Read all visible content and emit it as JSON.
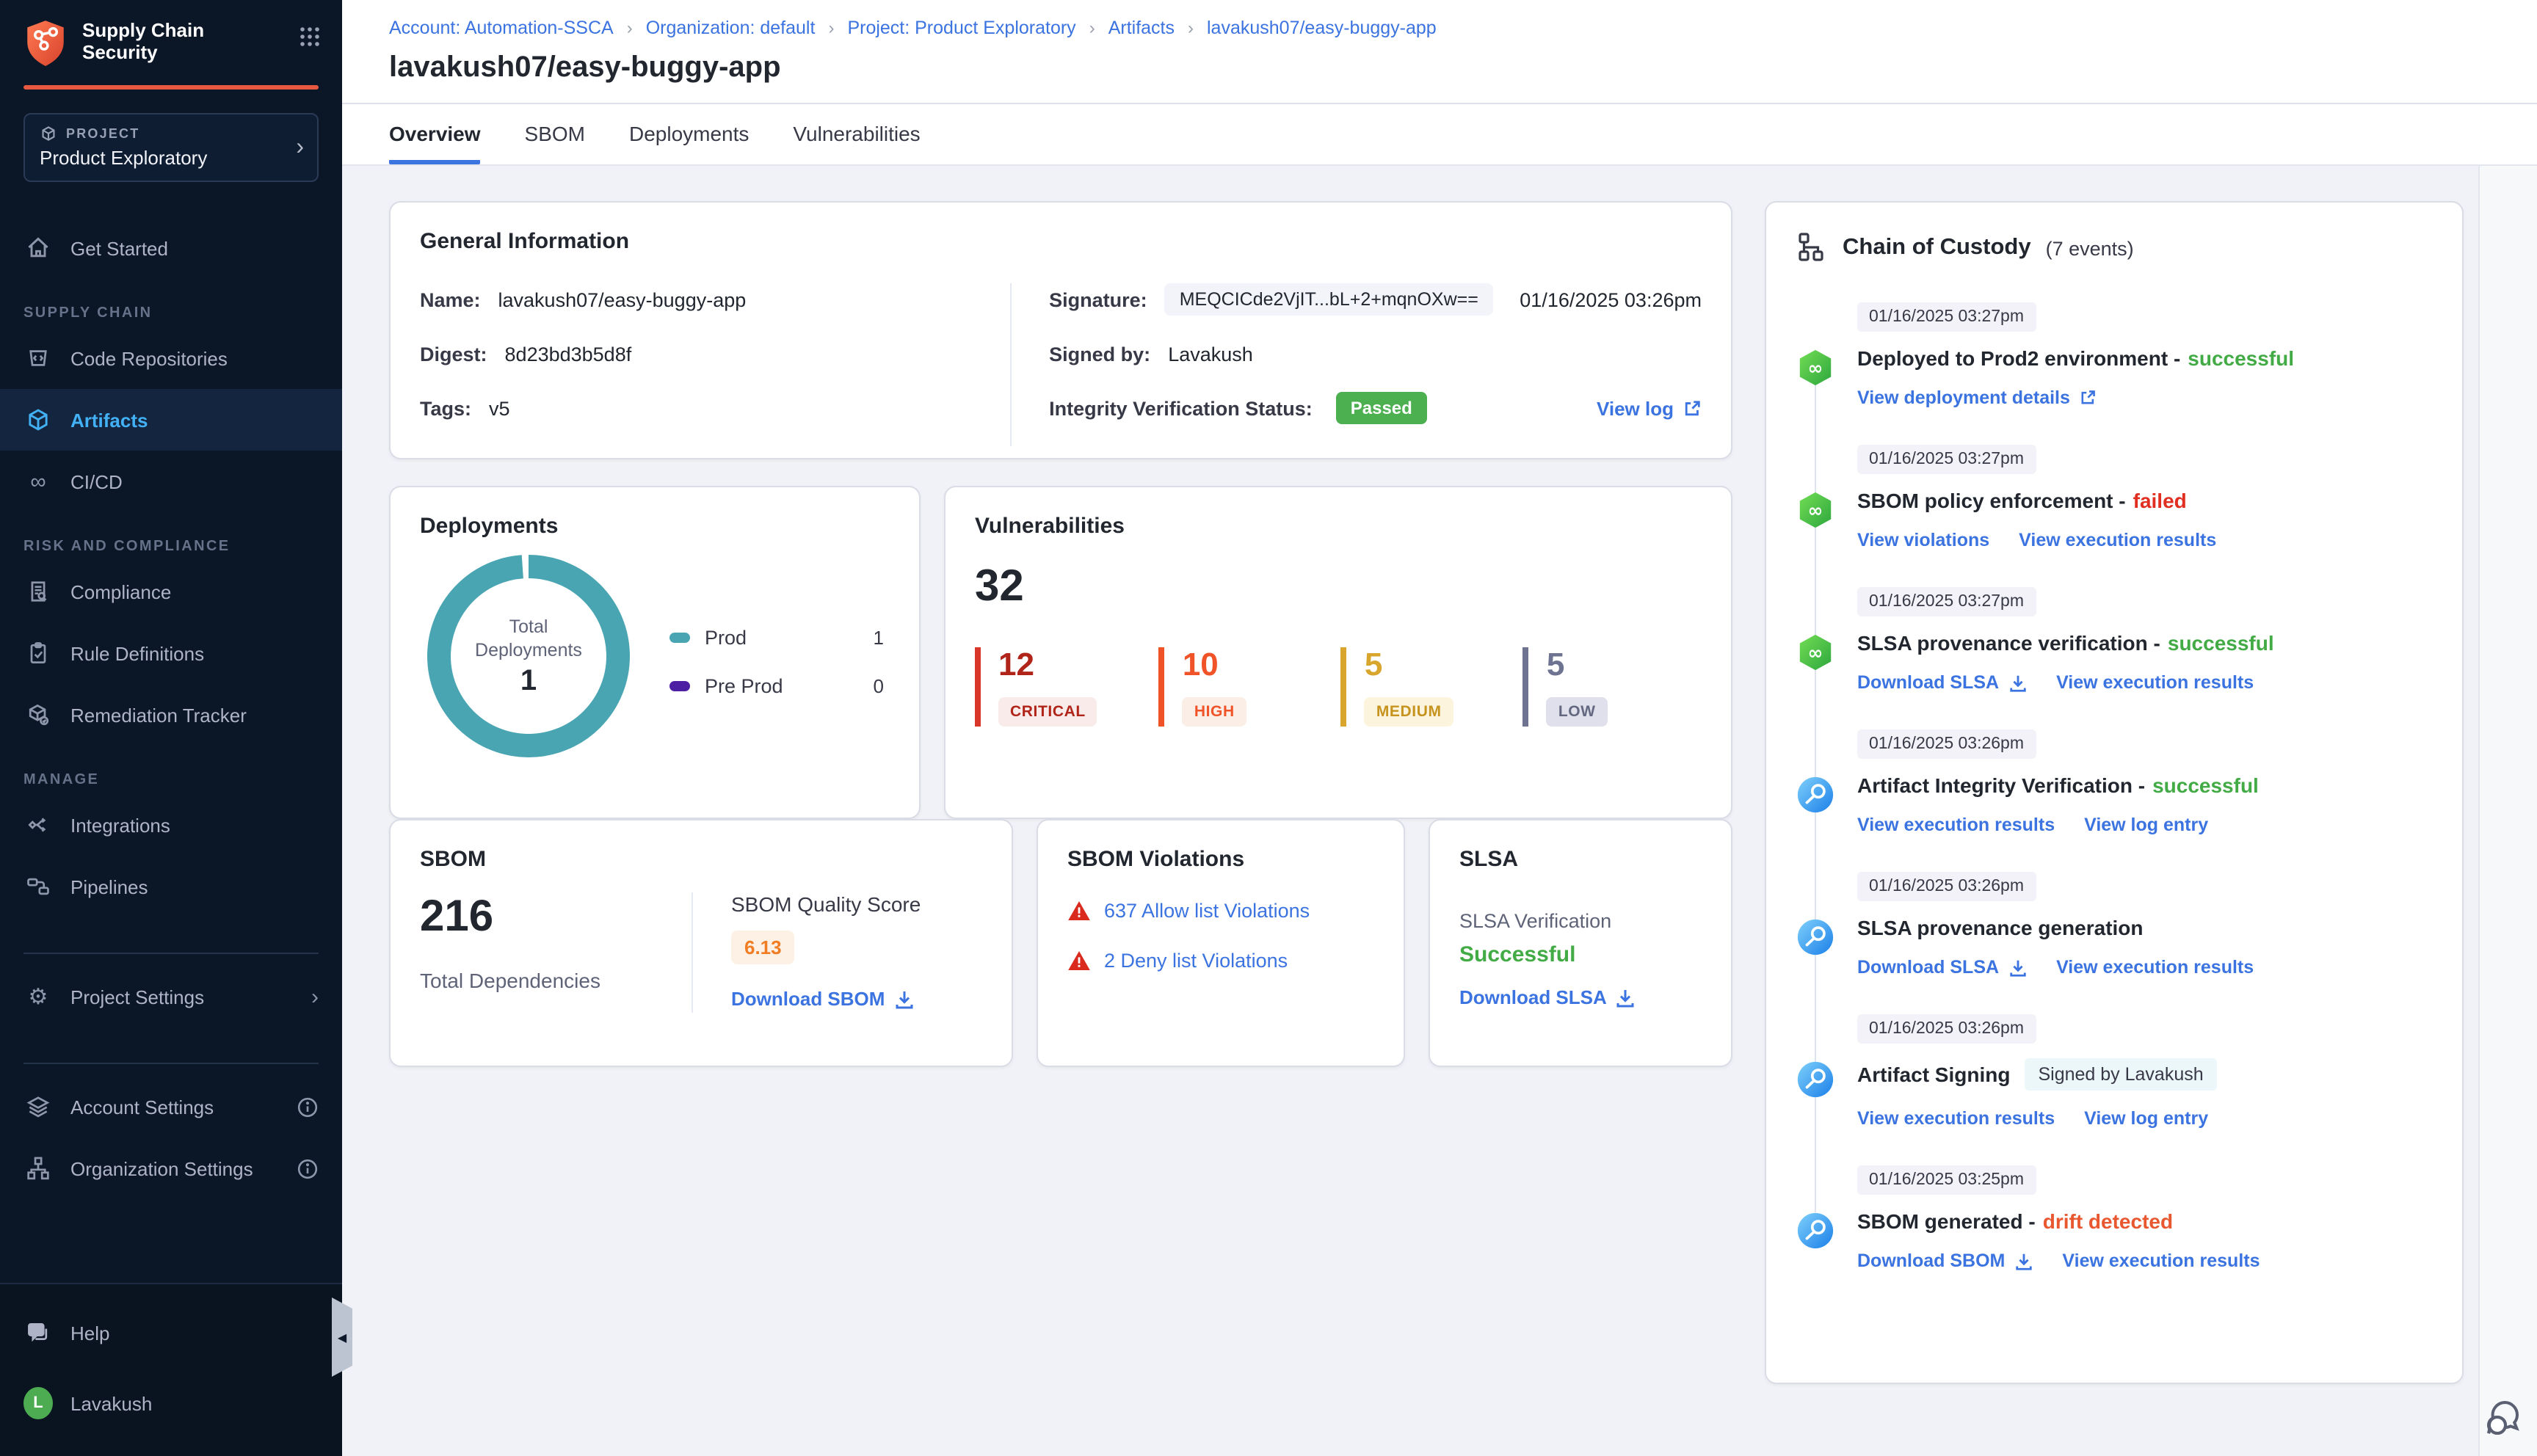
{
  "colors": {
    "accent_orange": "#e8573f",
    "link_blue": "#3b73e0",
    "sidebar_active_blue": "#42b1f5",
    "success_green": "#42ab45",
    "failed_red": "#e02f21",
    "drift_orange": "#e8572f",
    "passed_badge_green": "#4caf50",
    "donut_teal": "#4aa5b2",
    "preprod_purple": "#4d1fa3",
    "critical_red": "#b02419",
    "high_orange": "#f05327",
    "medium_gold": "#d8a62c",
    "low_slate": "#6e7391",
    "quality_score_orange": "#f07d23"
  },
  "app": {
    "name_line1": "Supply Chain",
    "name_line2": "Security"
  },
  "sidebar": {
    "project_label": "PROJECT",
    "project_name": "Product Exploratory",
    "sections": {
      "supply_chain": "SUPPLY CHAIN",
      "risk_compliance": "RISK AND COMPLIANCE",
      "manage": "MANAGE"
    },
    "items": {
      "get_started": "Get Started",
      "code_repositories": "Code Repositories",
      "artifacts": "Artifacts",
      "cicd": "CI/CD",
      "compliance": "Compliance",
      "rule_definitions": "Rule Definitions",
      "remediation_tracker": "Remediation Tracker",
      "integrations": "Integrations",
      "pipelines": "Pipelines",
      "project_settings": "Project Settings",
      "account_settings": "Account Settings",
      "organization_settings": "Organization Settings",
      "help": "Help"
    },
    "user": {
      "name": "Lavakush",
      "initial": "L"
    }
  },
  "breadcrumb": [
    "Account: Automation-SSCA",
    "Organization: default",
    "Project: Product Exploratory",
    "Artifacts",
    "lavakush07/easy-buggy-app"
  ],
  "page": {
    "title": "lavakush07/easy-buggy-app",
    "tabs": [
      "Overview",
      "SBOM",
      "Deployments",
      "Vulnerabilities"
    ]
  },
  "general_info": {
    "title": "General Information",
    "name_label": "Name:",
    "name": "lavakush07/easy-buggy-app",
    "digest_label": "Digest:",
    "digest": "8d23bd3b5d8f",
    "tags_label": "Tags:",
    "tags": "v5",
    "signature_label": "Signature:",
    "signature": "MEQCICde2VjIT...bL+2+mqnOXw==",
    "signature_date": "01/16/2025 03:26pm",
    "signed_by_label": "Signed by:",
    "signed_by": "Lavakush",
    "integrity_label": "Integrity Verification Status:",
    "integrity_status": "Passed",
    "view_log": "View log"
  },
  "deployments": {
    "title": "Deployments",
    "center_label_1": "Total",
    "center_label_2": "Deployments",
    "total": "1",
    "legend": [
      {
        "label": "Prod",
        "value": "1"
      },
      {
        "label": "Pre Prod",
        "value": "0"
      }
    ]
  },
  "vulnerabilities": {
    "title": "Vulnerabilities",
    "total": "32",
    "severities": [
      {
        "count": "12",
        "label": "CRITICAL"
      },
      {
        "count": "10",
        "label": "HIGH"
      },
      {
        "count": "5",
        "label": "MEDIUM"
      },
      {
        "count": "5",
        "label": "LOW"
      }
    ]
  },
  "sbom": {
    "title": "SBOM",
    "total": "216",
    "total_label": "Total Dependencies",
    "score_label": "SBOM Quality Score",
    "score": "6.13",
    "download": "Download SBOM"
  },
  "sbom_violations": {
    "title": "SBOM Violations",
    "rows": [
      {
        "label": "637 Allow list Violations"
      },
      {
        "label": "2 Deny list Violations"
      }
    ]
  },
  "slsa": {
    "title": "SLSA",
    "verification_label": "SLSA Verification",
    "status": "Successful",
    "download": "Download SLSA"
  },
  "chain": {
    "title": "Chain of Custody",
    "count": "(7 events)",
    "events": [
      {
        "timestamp": "01/16/2025 03:27pm",
        "icon": "pipeline",
        "title": "Deployed to Prod2 environment -",
        "status": "successful",
        "status_type": "success",
        "links": [
          {
            "label": "View deployment details",
            "icon": "external"
          }
        ]
      },
      {
        "timestamp": "01/16/2025 03:27pm",
        "icon": "pipeline",
        "title": "SBOM policy enforcement -",
        "status": "failed",
        "status_type": "failed",
        "links": [
          {
            "label": "View violations"
          },
          {
            "label": "View execution results"
          }
        ]
      },
      {
        "timestamp": "01/16/2025 03:27pm",
        "icon": "pipeline",
        "title": "SLSA provenance verification -",
        "status": "successful",
        "status_type": "success",
        "links": [
          {
            "label": "Download SLSA",
            "icon": "download"
          },
          {
            "label": "View execution results"
          }
        ]
      },
      {
        "timestamp": "01/16/2025 03:26pm",
        "icon": "scan",
        "title": "Artifact Integrity Verification -",
        "status": "successful",
        "status_type": "success",
        "links": [
          {
            "label": "View execution results"
          },
          {
            "label": "View log entry"
          }
        ]
      },
      {
        "timestamp": "01/16/2025 03:26pm",
        "icon": "scan",
        "title": "SLSA provenance generation",
        "status": "",
        "status_type": "",
        "links": [
          {
            "label": "Download SLSA",
            "icon": "download"
          },
          {
            "label": "View execution results"
          }
        ]
      },
      {
        "timestamp": "01/16/2025 03:26pm",
        "icon": "scan",
        "title": "Artifact Signing",
        "badge": "Signed by Lavakush",
        "status": "",
        "status_type": "",
        "links": [
          {
            "label": "View execution results"
          },
          {
            "label": "View log entry"
          }
        ]
      },
      {
        "timestamp": "01/16/2025 03:25pm",
        "icon": "scan",
        "title": "SBOM generated -",
        "status": "drift detected",
        "status_type": "drift",
        "links": [
          {
            "label": "Download SBOM",
            "icon": "download"
          },
          {
            "label": "View execution results"
          }
        ]
      }
    ]
  },
  "chart_data": {
    "type": "pie",
    "title": "Total Deployments",
    "categories": [
      "Prod",
      "Pre Prod"
    ],
    "values": [
      1,
      0
    ],
    "center_total": 1,
    "legend_position": "right",
    "colors": [
      "#4aa5b2",
      "#4d1fa3"
    ]
  }
}
